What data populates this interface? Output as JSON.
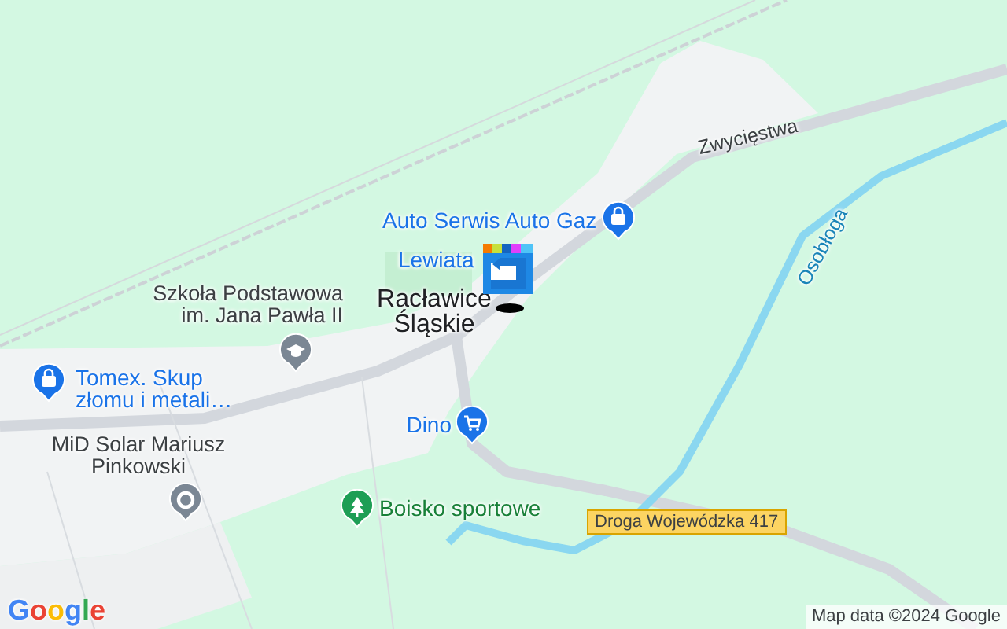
{
  "map": {
    "streets": [
      {
        "kind": "road",
        "label": "Zwycięstwa"
      },
      {
        "kind": "river",
        "label": "Osobłoga"
      }
    ],
    "town": {
      "lines": [
        "Racławice",
        "Śląskie"
      ]
    },
    "places": [
      {
        "kind": "shop",
        "lines": [
          "Auto Serwis Auto Gaz"
        ]
      },
      {
        "kind": "shop-hidden",
        "lines": [
          "Lewiata"
        ]
      },
      {
        "kind": "school",
        "lines": [
          "Szkoła Podstawowa",
          "im. Jana Pawła II"
        ]
      },
      {
        "kind": "shop",
        "lines": [
          "Tomex. Skup",
          "złomu i metali…"
        ]
      },
      {
        "kind": "store",
        "lines": [
          "Dino"
        ]
      },
      {
        "kind": "generic",
        "lines": [
          "MiD Solar Mariusz",
          "Pinkowski"
        ]
      },
      {
        "kind": "park",
        "lines": [
          "Boisko sportowe"
        ]
      }
    ],
    "road_shield": "Droga Wojewódzka 417",
    "logo": "Google",
    "attribution": "Map data ©2024 Google"
  }
}
